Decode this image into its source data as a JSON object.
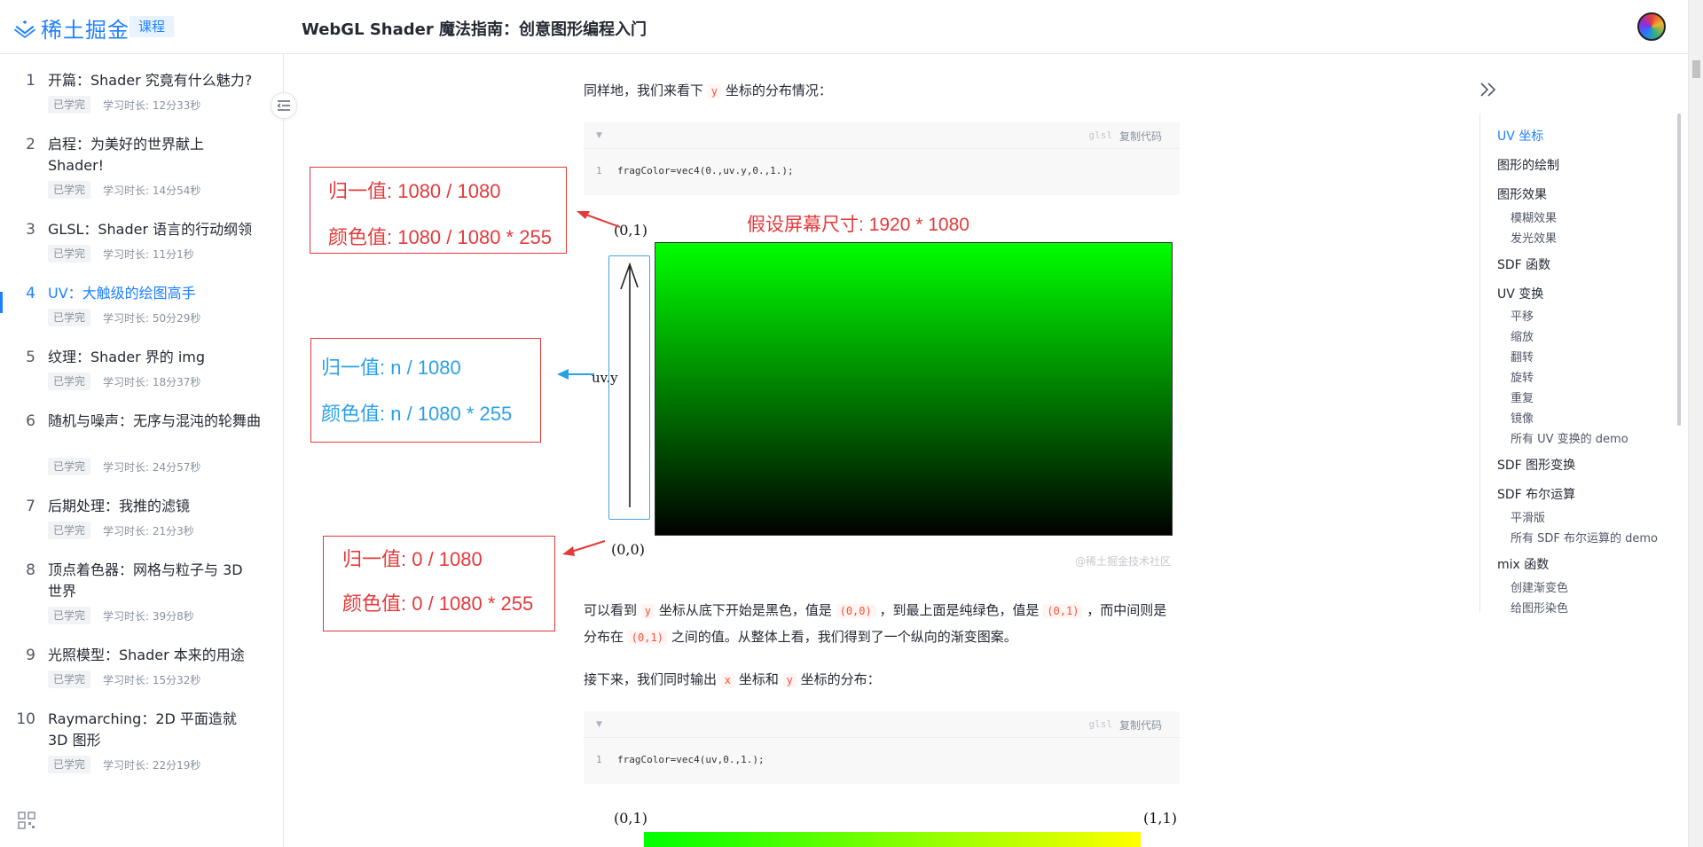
{
  "header": {
    "logo_text": "稀土掘金",
    "course_badge": "课程",
    "course_title": "WebGL Shader 魔法指南：创意图形编程入门"
  },
  "sidebar": {
    "chapters": [
      {
        "num": "1",
        "title": "开篇：Shader 究竟有什么魅力?",
        "tag": "已学完",
        "duration": "学习时长: 12分33秒"
      },
      {
        "num": "2",
        "title": "启程：为美好的世界献上 Shader!",
        "tag": "已学完",
        "duration": "学习时长: 14分54秒"
      },
      {
        "num": "3",
        "title": "GLSL：Shader 语言的行动纲领",
        "tag": "已学完",
        "duration": "学习时长: 11分1秒"
      },
      {
        "num": "4",
        "title": "UV：大触级的绘图高手",
        "tag": "已学完",
        "duration": "学习时长: 50分29秒"
      },
      {
        "num": "5",
        "title": "纹理：Shader 界的 img",
        "tag": "已学完",
        "duration": "学习时长: 18分37秒"
      },
      {
        "num": "6",
        "title": "随机与噪声：无序与混沌的轮舞曲",
        "tag": "已学完",
        "duration": "学习时长: 24分57秒"
      },
      {
        "num": "7",
        "title": "后期处理：我推的滤镜",
        "tag": "已学完",
        "duration": "学习时长: 21分3秒"
      },
      {
        "num": "8",
        "title": "顶点着色器：网格与粒子与 3D 世界",
        "tag": "已学完",
        "duration": "学习时长: 39分8秒"
      },
      {
        "num": "9",
        "title": "光照模型：Shader 本来的用途",
        "tag": "已学完",
        "duration": "学习时长: 15分32秒"
      },
      {
        "num": "10",
        "title": "Raymarching：2D 平面造就 3D 图形",
        "tag": "已学完",
        "duration": "学习时长: 22分19秒"
      }
    ]
  },
  "article": {
    "p1_a": "同样地，我们来看下",
    "p1_code": "y",
    "p1_b": "坐标的分布情况：",
    "code1": {
      "lang": "glsl",
      "copy": "复制代码",
      "line": "1",
      "src": "fragColor=vec4(0.,uv.y,0.,1.);"
    },
    "fig1": {
      "box1_l1": "归一值: 1080 / 1080",
      "box1_l2": "颜色值: 1080 / 1080 * 255",
      "box2_l1": "归一值: n / 1080",
      "box2_l2": "颜色值: n / 1080 * 255",
      "box3_l1": "归一值: 0 / 1080",
      "box3_l2": "颜色值: 0 / 1080 * 255",
      "screen_size": "假设屏幕尺寸: 1920 * 1080",
      "top_coord": "(0,1)",
      "bottom_coord": "(0,0)",
      "uv_label": "uv.y",
      "watermark": "@稀土掘金技术社区"
    },
    "p2_a": "可以看到",
    "p2_c1": "y",
    "p2_b": "坐标从底下开始是黑色，值是",
    "p2_c2": "(0,0)",
    "p2_c": "，到最上面是纯绿色，值是",
    "p2_c3": "(0,1)",
    "p2_d": "，而中间则是分布在",
    "p2_c4": "(0,1)",
    "p2_e": "之间的值。从整体上看，我们得到了一个纵向的渐变图案。",
    "p3_a": "接下来，我们同时输出",
    "p3_c1": "x",
    "p3_b": "坐标和",
    "p3_c2": "y",
    "p3_c": "坐标的分布：",
    "code2": {
      "lang": "glsl",
      "copy": "复制代码",
      "line": "1",
      "src": "fragColor=vec4(uv,0.,1.);"
    },
    "fig2": {
      "top_left": "(0,1)",
      "top_right": "(1,1)"
    }
  },
  "toc": {
    "items": [
      {
        "label": "UV 坐标",
        "level": 1,
        "active": true
      },
      {
        "label": "图形的绘制",
        "level": 1
      },
      {
        "label": "图形效果",
        "level": 1
      },
      {
        "label": "模糊效果",
        "level": 2
      },
      {
        "label": "发光效果",
        "level": 2
      },
      {
        "label": "SDF 函数",
        "level": 1
      },
      {
        "label": "UV 变换",
        "level": 1
      },
      {
        "label": "平移",
        "level": 2
      },
      {
        "label": "缩放",
        "level": 2
      },
      {
        "label": "翻转",
        "level": 2
      },
      {
        "label": "旋转",
        "level": 2
      },
      {
        "label": "重复",
        "level": 2
      },
      {
        "label": "镜像",
        "level": 2
      },
      {
        "label": "所有 UV 变换的 demo",
        "level": 2
      },
      {
        "label": "SDF 图形变换",
        "level": 1
      },
      {
        "label": "SDF 布尔运算",
        "level": 1
      },
      {
        "label": "平滑版",
        "level": 2
      },
      {
        "label": "所有 SDF 布尔运算的 demo",
        "level": 2
      },
      {
        "label": "mix 函数",
        "level": 1
      },
      {
        "label": "创建渐变色",
        "level": 2
      },
      {
        "label": "给图形染色",
        "level": 2
      }
    ]
  },
  "colors": {
    "accent": "#1e80ff",
    "annot_red": "#e5393a",
    "annot_blue": "#2aa0e8"
  }
}
